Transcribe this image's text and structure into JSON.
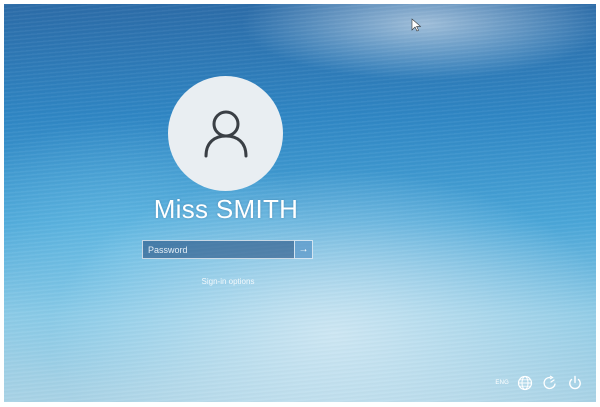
{
  "user": {
    "name": "Miss SMITH"
  },
  "password": {
    "placeholder": "Password",
    "submit_glyph": "→"
  },
  "signin_options": {
    "label": "Sign-in options"
  },
  "tray": {
    "language": "ENG"
  },
  "icons": {
    "avatar": "user-silhouette-icon",
    "network": "globe-network-icon",
    "accessibility": "ease-of-access-icon",
    "power": "power-icon",
    "cursor": "mouse-pointer-icon"
  },
  "colors": {
    "accent": "#2f86c4",
    "avatar_bg": "#e9eef2",
    "text": "#ffffff"
  }
}
